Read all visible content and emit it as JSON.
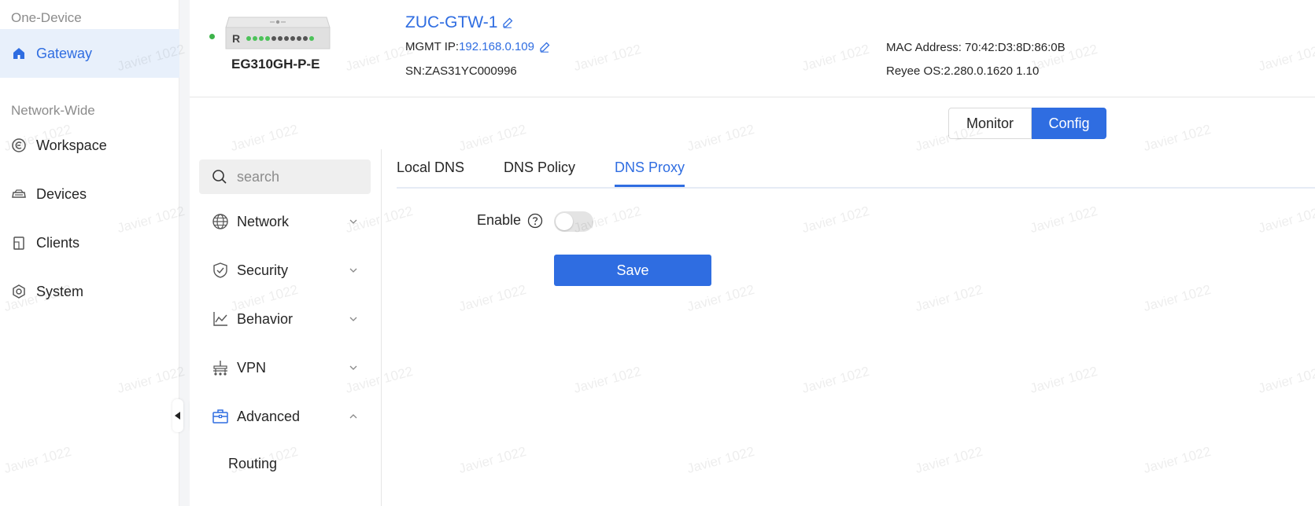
{
  "sidebar": {
    "section_one": "One-Device",
    "gateway_label": "Gateway",
    "section_two": "Network-Wide",
    "items": [
      {
        "label": "Workspace",
        "icon": "workspace-icon"
      },
      {
        "label": "Devices",
        "icon": "devices-icon"
      },
      {
        "label": "Clients",
        "icon": "clients-icon"
      },
      {
        "label": "System",
        "icon": "system-icon"
      }
    ]
  },
  "device": {
    "model": "EG310GH-P-E",
    "name": "ZUC-GTW-1",
    "mgmt_label": "MGMT IP:",
    "mgmt_ip": "192.168.0.109",
    "sn": "SN:ZAS31YC000996",
    "mac": "MAC Address: 70:42:D3:8D:86:0B",
    "os": "Reyee OS:2.280.0.1620 1.10",
    "logo_letter": "R",
    "status": "online",
    "status_color": "#3db34a"
  },
  "mode": {
    "monitor": "Monitor",
    "config": "Config",
    "active": "Config"
  },
  "search": {
    "placeholder": "search"
  },
  "menu": {
    "items": [
      {
        "label": "Network",
        "icon": "globe-icon",
        "expanded": false
      },
      {
        "label": "Security",
        "icon": "shield-icon",
        "expanded": false
      },
      {
        "label": "Behavior",
        "icon": "chart-icon",
        "expanded": false
      },
      {
        "label": "VPN",
        "icon": "vpn-icon",
        "expanded": false
      },
      {
        "label": "Advanced",
        "icon": "toolbox-icon",
        "expanded": true
      }
    ],
    "sub_items": [
      {
        "label": "Routing"
      }
    ]
  },
  "tabs": [
    {
      "label": "Local DNS"
    },
    {
      "label": "DNS Policy"
    },
    {
      "label": "DNS Proxy"
    }
  ],
  "active_tab": "DNS Proxy",
  "form": {
    "enable_label": "Enable",
    "enable_value": false,
    "save_label": "Save"
  },
  "watermark": "Javier 1022",
  "colors": {
    "accent": "#2f6de1",
    "active_bg": "#e8f0fb",
    "status_green": "#3db34a"
  }
}
